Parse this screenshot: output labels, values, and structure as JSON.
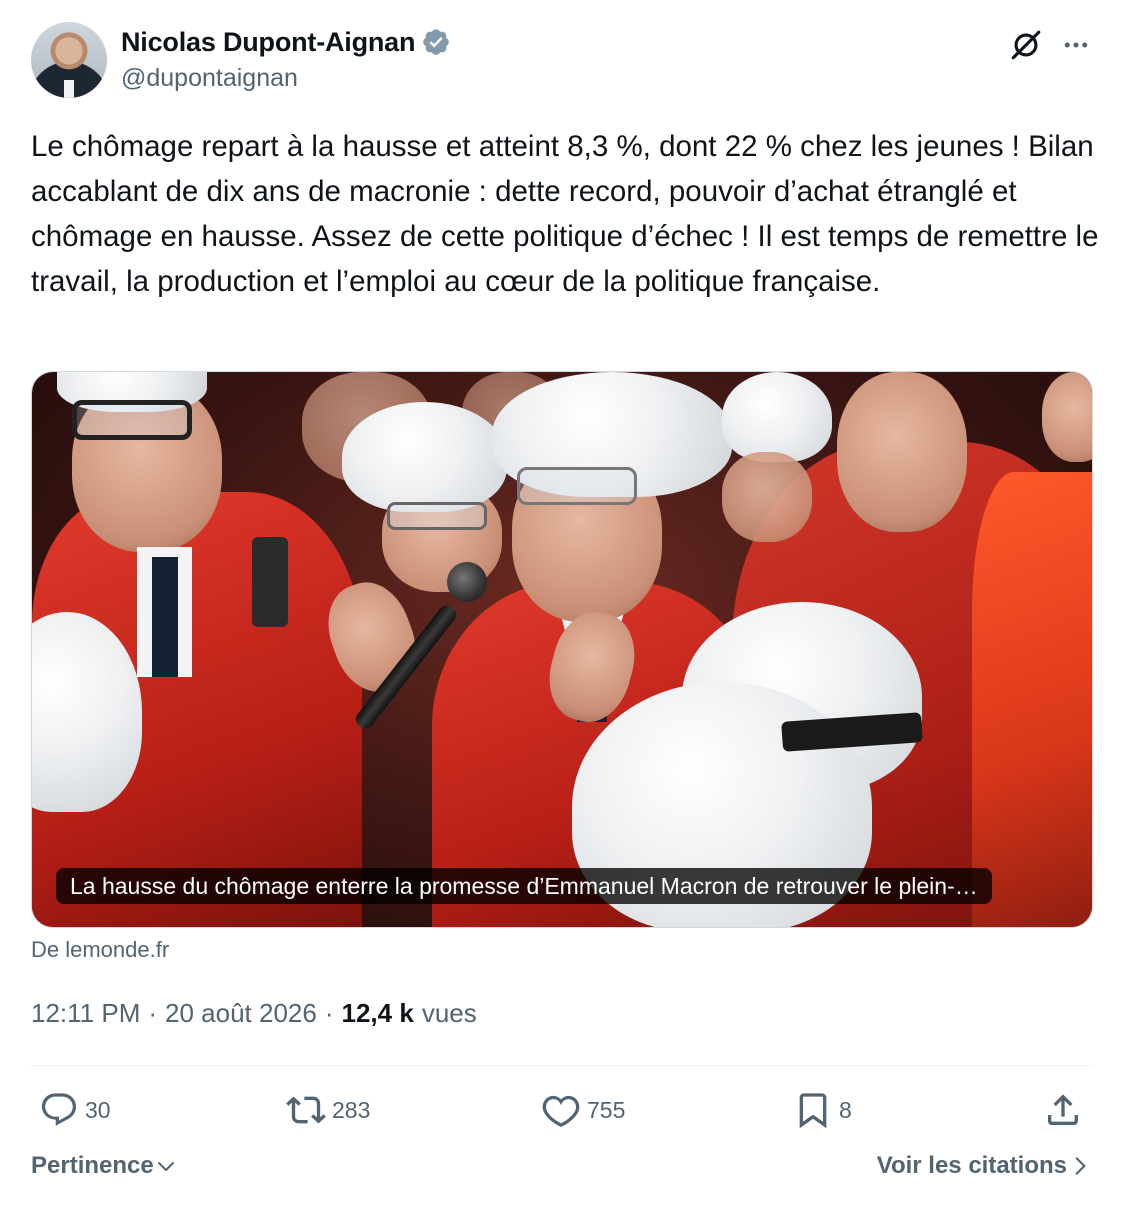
{
  "author": {
    "display_name": "Nicolas Dupont-Aignan",
    "handle": "@dupontaignan",
    "verified": true
  },
  "tweet": {
    "text": "Le chômage repart à la hausse et atteint 8,3 %, dont 22 % chez les jeunes ! Bilan accablant de dix ans de macronie : dette record, pouvoir d’achat étranglé et chômage en hausse. Assez de cette politique d’échec ! Il est temps de remettre le travail, la production et l’emploi au cœur de la politique française."
  },
  "card": {
    "caption": "La hausse du chômage enterre la promesse d’Emmanuel Macron de retrouver le plein-…",
    "source": "De lemonde.fr"
  },
  "meta": {
    "time": "12:11 PM",
    "date": "20 août 2026",
    "views_count": "12,4 k",
    "views_label": "vues"
  },
  "actions": {
    "replies": "30",
    "reposts": "283",
    "likes": "755",
    "bookmarks": "8"
  },
  "footer": {
    "sort_label": "Pertinence",
    "quotes_label": "Voir les citations"
  },
  "colors": {
    "text": "#0f1419",
    "secondary": "#536471",
    "verified": "#829aab",
    "border": "#cfd9de"
  },
  "icons": {
    "verified": "verified-badge-icon",
    "grok": "grok-icon",
    "more": "more-icon",
    "reply": "reply-icon",
    "repost": "repost-icon",
    "like": "heart-icon",
    "bookmark": "bookmark-icon",
    "share": "share-icon",
    "chevron_down": "chevron-down-icon",
    "chevron_right": "chevron-right-icon"
  }
}
